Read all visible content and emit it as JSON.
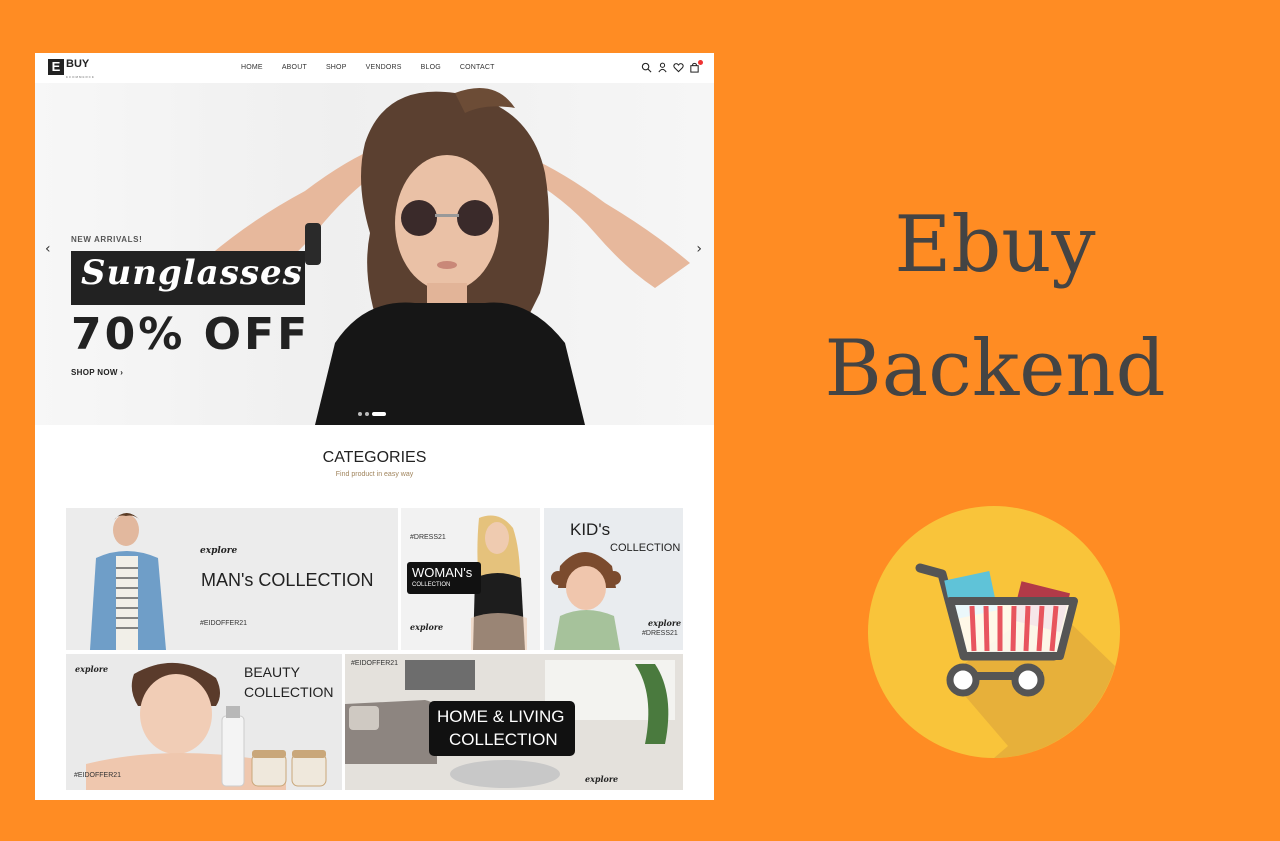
{
  "site": {
    "logo": {
      "letter": "E",
      "name": "BUY",
      "tagline": "ECOMMERCE"
    },
    "nav": [
      "HOME",
      "ABOUT",
      "SHOP",
      "VENDORS",
      "BLOG",
      "CONTACT"
    ],
    "icons": [
      "search-icon",
      "user-icon",
      "heart-icon",
      "cart-icon"
    ],
    "hero": {
      "kicker": "NEW ARRIVALS!",
      "promo_word": "Sunglasses",
      "discount": "70% OFF",
      "cta": "SHOP NOW",
      "prev": "‹",
      "next": "›",
      "slides_total": 3,
      "active_slide": 3
    },
    "categories": {
      "title": "CATEGORIES",
      "subtitle": "Find product in easy way",
      "men": {
        "explore": "explore",
        "title": "MAN's COLLECTION",
        "tag": "#EIDOFFER21"
      },
      "women": {
        "tag": "#DRESS21",
        "title": "WOMAN's",
        "sub": "COLLECTION",
        "explore": "explore"
      },
      "kids": {
        "title": "KID's",
        "sub": "COLLECTION",
        "explore": "explore",
        "tag": "#DRESS21"
      },
      "beauty": {
        "explore": "explore",
        "title": "BEAUTY",
        "sub": "COLLECTION",
        "tag": "#EIDOFFER21"
      },
      "home": {
        "tag": "#EIDOFFER21",
        "title": "HOME & LIVING",
        "sub": "COLLECTION",
        "explore": "explore"
      }
    }
  },
  "banner": {
    "line1": "Ebuy",
    "line2": "Backend"
  },
  "colors": {
    "background": "#FF8C23",
    "cart_circle": "#F9C43A",
    "text": "#444444"
  }
}
